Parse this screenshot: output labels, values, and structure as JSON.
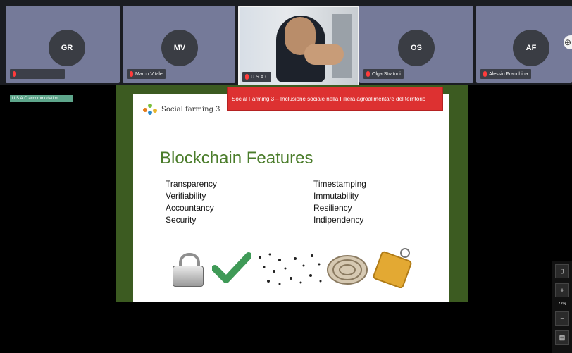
{
  "participants": [
    {
      "initials": "GR",
      "name": ""
    },
    {
      "initials": "MV",
      "name": "Marco Vitale"
    },
    {
      "initials": "",
      "name": "U.S.A.C"
    },
    {
      "initials": "OS",
      "name": "Olga Stratoni"
    },
    {
      "initials": "AF",
      "name": "Alessio Franchina"
    }
  ],
  "side_tag": "U.S.A.C.accommodation",
  "banner_text": "Social Farming 3 – Inclusione sociale nella Filiera agroalimentare del territorio",
  "slide": {
    "logo_text": "Social farming 3",
    "title": "Blockchain Features",
    "features_left": [
      "Transparency",
      "Verifiability",
      "Accountancy",
      "Security"
    ],
    "features_right": [
      "Timestamping",
      "Immutability",
      "Resiliency",
      "Indipendency"
    ]
  },
  "toolbar": {
    "camera_icon": "camera-icon",
    "zoom_in": "+",
    "zoom_value": "77%",
    "zoom_out": "−",
    "export_icon": "doc-icon"
  },
  "colors": {
    "tile": "#757a99",
    "banner": "#dd3131",
    "frame": "#3c5b21",
    "title": "#4a7c2a",
    "tag": "#5ea68b"
  }
}
